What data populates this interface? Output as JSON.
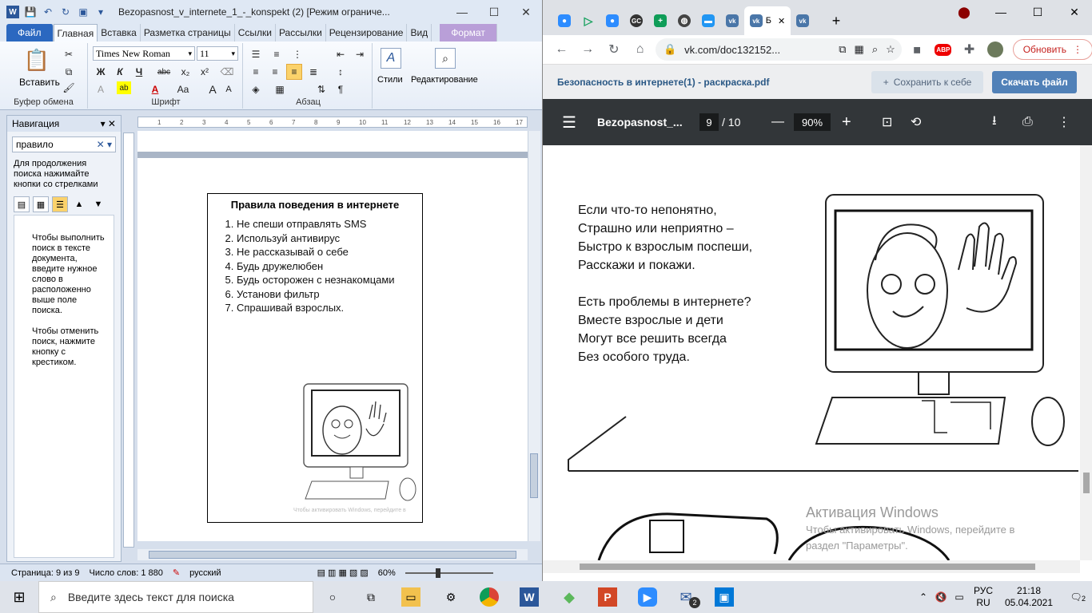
{
  "word": {
    "title": "Bezopasnost_v_internete_1_-_konspekt (2) [Режим ограниче...",
    "tabs": [
      "Файл",
      "Главная",
      "Вставка",
      "Разметка страницы",
      "Ссылки",
      "Рассылки",
      "Рецензирование",
      "Вид",
      "Формат"
    ],
    "ribbon": {
      "paste": "Вставить",
      "clipboard": "Буфер обмена",
      "font_name": "Times New Roman",
      "font_size": "11",
      "font_group": "Шрифт",
      "para_group": "Абзац",
      "styles": "Стили",
      "editing": "Редактирование",
      "bold": "Ж",
      "italic": "К",
      "underline": "Ч",
      "strike": "abc",
      "sub": "x₂",
      "sup": "x²",
      "grow": "A",
      "shrink": "A",
      "case": "Aa",
      "pilcrow": "¶"
    },
    "nav": {
      "title": "Навигация",
      "search_value": "правило",
      "hint": "Для продолжения поиска нажимайте кнопки со стрелками",
      "body1": "Чтобы выполнить поиск в тексте документа, введите нужное слово в расположенно выше поле поиска.",
      "body2": "Чтобы отменить поиск, нажмите кнопку с крестиком."
    },
    "ruler": {
      "ticks": [
        "1",
        "2",
        "3",
        "4",
        "5",
        "6",
        "7",
        "8",
        "9",
        "10",
        "11",
        "12",
        "13",
        "14",
        "15",
        "16",
        "17"
      ]
    },
    "doc": {
      "box_title": "Правила поведения в интернете",
      "rules": [
        "Не спеши отправлять SMS",
        "Используй антивирус",
        "Не рассказывай о себе",
        "Будь дружелюбен",
        "Будь осторожен с незнакомцами",
        "Установи фильтр",
        "Спрашивай взрослых."
      ],
      "watermark": "Чтобы активировать Windows, перейдите в"
    },
    "status": {
      "page": "Страница: 9 из 9",
      "words": "Число слов: 1 880",
      "lang": "русский",
      "zoom": "60%"
    }
  },
  "chrome": {
    "active_tab": "Б",
    "url": "vk.com/doc132152...",
    "update": "Обновить",
    "vk": {
      "file": "Безопасность в интернете(1) - раскраска.pdf",
      "save": "Сохранить к себе",
      "download": "Скачать файл"
    },
    "pdf": {
      "name": "Bezopasnost_...",
      "page": "9",
      "total": "/ 10",
      "zoom": "90%"
    },
    "poem": {
      "stanza1": [
        "Если что-то непонятно,",
        "Страшно или неприятно –",
        "Быстро к взрослым поспеши,",
        "Расскажи и покажи."
      ],
      "stanza2": [
        "Есть проблемы в интернете?",
        "Вместе взрослые и дети",
        "Могут все решить всегда",
        "Без особого труда."
      ]
    },
    "activation": {
      "title": "Активация Windows",
      "line1": "Чтобы активировать Windows, перейдите в",
      "line2": "раздел \"Параметры\"."
    }
  },
  "taskbar": {
    "search": "Введите здесь текст для поиска",
    "lang1": "РУС",
    "lang2": "RU",
    "time": "21:18",
    "date": "05.04.2021",
    "notif": "2",
    "mail_badge": "2"
  },
  "colors": {
    "word_blue": "#2b579a",
    "vk_blue": "#5181b8",
    "pdf_bar": "#323639"
  }
}
